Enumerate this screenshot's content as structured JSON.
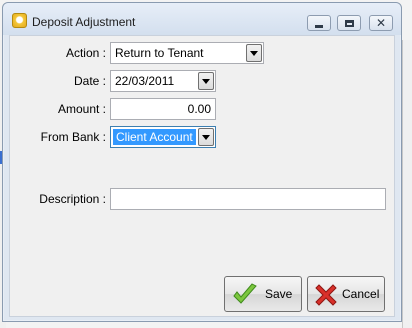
{
  "window": {
    "title": "Deposit Adjustment",
    "icon": "app-icon"
  },
  "form": {
    "action": {
      "label": "Action :",
      "value": "Return to Tenant"
    },
    "date": {
      "label": "Date :",
      "value": "22/03/2011"
    },
    "amount": {
      "label": "Amount :",
      "value": "0.00"
    },
    "from_bank": {
      "label": "From Bank :",
      "value": "Client Account"
    },
    "description": {
      "label": "Description :",
      "value": ""
    }
  },
  "buttons": {
    "save": "Save",
    "cancel": "Cancel"
  },
  "colors": {
    "selection": "#3399ff",
    "save_icon": "#7cc63e",
    "cancel_icon": "#d9302a"
  }
}
